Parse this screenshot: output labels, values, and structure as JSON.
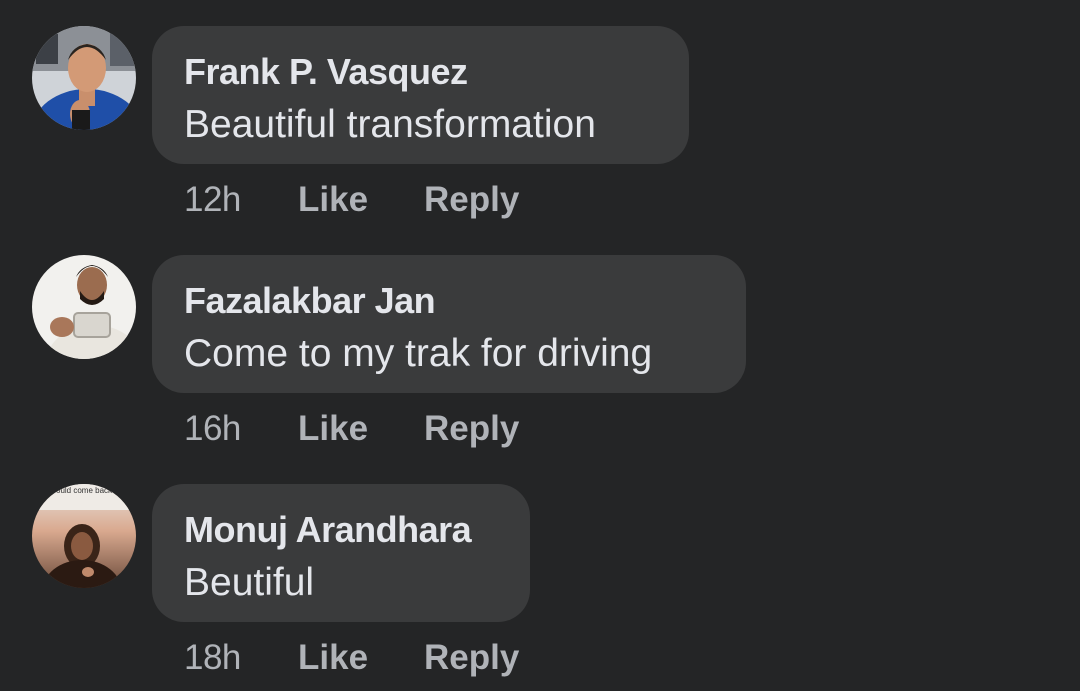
{
  "comments": [
    {
      "author": "Frank P. Vasquez",
      "text": "Beautiful transformation",
      "time": "12h",
      "like_label": "Like",
      "reply_label": "Reply"
    },
    {
      "author": "Fazalakbar Jan",
      "text": "Come to my trak for driving",
      "time": "16h",
      "like_label": "Like",
      "reply_label": "Reply"
    },
    {
      "author": "Monuj Arandhara",
      "text": "Beutiful",
      "time": "18h",
      "like_label": "Like",
      "reply_label": "Reply",
      "avatar_caption": "could come back / d the earth and start o"
    }
  ],
  "colors": {
    "background": "#242526",
    "bubble": "#3a3b3c",
    "primary_text": "#e4e6eb",
    "secondary_text": "#b0b3b8"
  }
}
